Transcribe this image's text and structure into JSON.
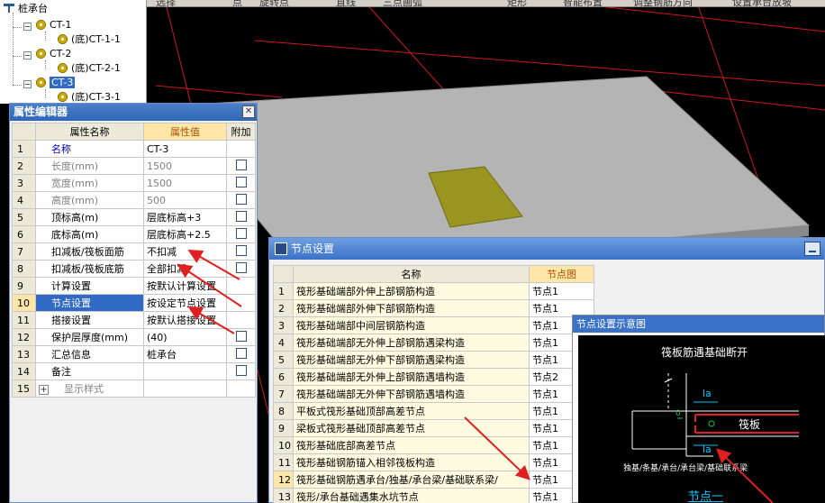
{
  "toolbar": {
    "fragments": [
      "选择",
      "点",
      "旋转点",
      "直线",
      "三点画弧",
      "矩形",
      "智能布置",
      "调整钢筋方向",
      "设置承台放坡"
    ]
  },
  "tree": {
    "root": "桩承台",
    "groups": [
      {
        "name": "CT-1",
        "child": "(底)CT-1-1"
      },
      {
        "name": "CT-2",
        "child": "(底)CT-2-1"
      },
      {
        "name": "CT-3",
        "child": "(底)CT-3-1"
      }
    ]
  },
  "property_editor": {
    "title": "属性编辑器",
    "headers": {
      "name": "属性名称",
      "value": "属性值",
      "extra": "附加"
    },
    "rows": [
      {
        "n": "1",
        "name": "名称",
        "value": "CT-3",
        "style": "blue",
        "checkbox": false
      },
      {
        "n": "2",
        "name": "长度(mm)",
        "value": "1500",
        "style": "grey",
        "checkbox": true
      },
      {
        "n": "3",
        "name": "宽度(mm)",
        "value": "1500",
        "style": "grey",
        "checkbox": true
      },
      {
        "n": "4",
        "name": "高度(mm)",
        "value": "500",
        "style": "grey",
        "checkbox": true
      },
      {
        "n": "5",
        "name": "顶标高(m)",
        "value": "层底标高+3",
        "style": "",
        "checkbox": true
      },
      {
        "n": "6",
        "name": "底标高(m)",
        "value": "层底标高+2.5",
        "style": "",
        "checkbox": true
      },
      {
        "n": "7",
        "name": "扣减板/筏板面筋",
        "value": "不扣减",
        "style": "",
        "checkbox": true
      },
      {
        "n": "8",
        "name": "扣减板/筏板底筋",
        "value": "全部扣减",
        "style": "",
        "checkbox": true
      },
      {
        "n": "9",
        "name": "计算设置",
        "value": "按默认计算设置",
        "style": "",
        "checkbox": false
      },
      {
        "n": "10",
        "name": "节点设置",
        "value": "按设定节点设置",
        "style": "",
        "checkbox": false,
        "selected": true
      },
      {
        "n": "11",
        "name": "搭接设置",
        "value": "按默认搭接设置",
        "style": "",
        "checkbox": false
      },
      {
        "n": "12",
        "name": "保护层厚度(mm)",
        "value": "(40)",
        "style": "",
        "checkbox": true
      },
      {
        "n": "13",
        "name": "汇总信息",
        "value": "桩承台",
        "style": "",
        "checkbox": true
      },
      {
        "n": "14",
        "name": "备注",
        "value": "",
        "style": "",
        "checkbox": true
      },
      {
        "n": "15",
        "name": "显示样式",
        "value": "",
        "style": "grey",
        "checkbox": false,
        "expander": "+"
      }
    ]
  },
  "node_dialog": {
    "title": "节点设置",
    "headers": {
      "name": "名称",
      "node": "节点图"
    },
    "rows": [
      {
        "n": "1",
        "name": "筏形基础端部外伸上部钢筋构造",
        "node": "节点1"
      },
      {
        "n": "2",
        "name": "筏形基础端部外伸下部钢筋构造",
        "node": "节点1"
      },
      {
        "n": "3",
        "name": "筏形基础端部中间层钢筋构造",
        "node": "节点1"
      },
      {
        "n": "4",
        "name": "筏形基础端部无外伸上部钢筋遇梁构造",
        "node": "节点1"
      },
      {
        "n": "5",
        "name": "筏形基础端部无外伸下部钢筋遇梁构造",
        "node": "节点1"
      },
      {
        "n": "6",
        "name": "筏形基础端部无外伸上部钢筋遇墙构造",
        "node": "节点2"
      },
      {
        "n": "7",
        "name": "筏形基础端部无外伸下部钢筋遇墙构造",
        "node": "节点1"
      },
      {
        "n": "8",
        "name": "平板式筏形基础顶部高差节点",
        "node": "节点1"
      },
      {
        "n": "9",
        "name": "梁板式筏形基础顶部高差节点",
        "node": "节点1"
      },
      {
        "n": "10",
        "name": "筏形基础底部高差节点",
        "node": "节点1"
      },
      {
        "n": "11",
        "name": "筏形基础钢筋锚入相邻筏板构造",
        "node": "节点1"
      },
      {
        "n": "12",
        "name": "筏形基础钢筋遇承台/独基/承台梁/基础联系梁/",
        "node": "节点1",
        "selected": true
      },
      {
        "n": "13",
        "name": "筏形/承台基础遇集水坑节点",
        "node": "节点1"
      }
    ]
  },
  "schematic": {
    "title": "节点设置示意图",
    "heading": "筏板筋遇基础断开",
    "label_la_top": "la",
    "label_la_bottom": "la",
    "label_slab": "筏板",
    "label_zero": "0",
    "caption": "独基/条基/承台/承台梁/基础联系梁",
    "node_name": "节点一"
  },
  "colors": {
    "title_blue": "#316ac5",
    "slab_grey": "#b4b4b4",
    "pile_cap_olive": "#9a9420",
    "grid_red": "#d01818",
    "annotation_red": "#e02020",
    "schematic_green": "#22c040",
    "schematic_cyan": "#00c8ff"
  }
}
